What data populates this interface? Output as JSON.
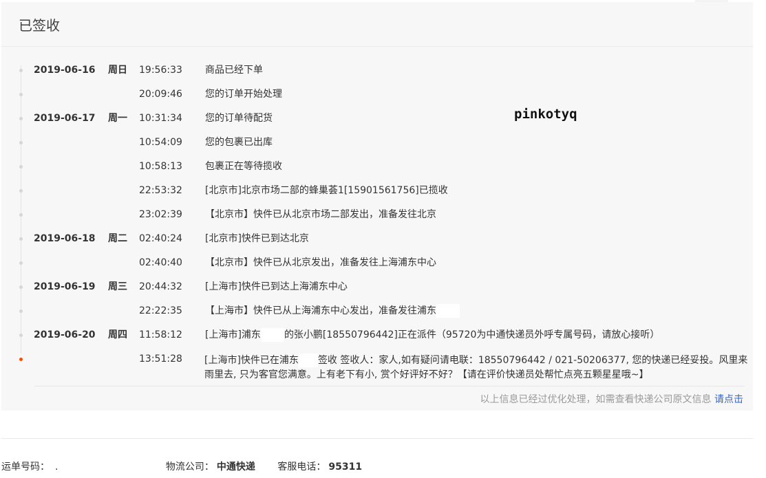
{
  "header": {
    "title": "已签收"
  },
  "watermark": "pinkotyq",
  "events": [
    {
      "date": "2019-06-16",
      "weekday": "周日",
      "time": "19:56:33",
      "desc": "商品已经下单"
    },
    {
      "date": "",
      "weekday": "",
      "time": "20:09:46",
      "desc": "您的订单开始处理"
    },
    {
      "date": "2019-06-17",
      "weekday": "周一",
      "time": "10:31:34",
      "desc": "您的订单待配货"
    },
    {
      "date": "",
      "weekday": "",
      "time": "10:54:09",
      "desc": "您的包裹已出库"
    },
    {
      "date": "",
      "weekday": "",
      "time": "10:58:13",
      "desc": "包裹正在等待揽收"
    },
    {
      "date": "",
      "weekday": "",
      "time": "22:53:32",
      "desc": "[北京市]北京市场二部的蜂巢荟1[15901561756]已揽收"
    },
    {
      "date": "",
      "weekday": "",
      "time": "23:02:39",
      "desc": "【北京市】快件已从北京市场二部发出，准备发往北京"
    },
    {
      "date": "2019-06-18",
      "weekday": "周二",
      "time": "02:40:24",
      "desc": "[北京市]快件已到达北京"
    },
    {
      "date": "",
      "weekday": "",
      "time": "02:40:40",
      "desc": "【北京市】快件已从北京发出，准备发往上海浦东中心"
    },
    {
      "date": "2019-06-19",
      "weekday": "周三",
      "time": "20:44:32",
      "desc": "[上海市]快件已到达上海浦东中心"
    },
    {
      "date": "",
      "weekday": "",
      "time": "22:22:35",
      "desc_a": "【上海市】快件已从上海浦东中心发出，准备发往浦东"
    },
    {
      "date": "2019-06-20",
      "weekday": "周四",
      "time": "11:58:12",
      "desc_a": "[上海市]浦东",
      "desc_b": "的张小鹏[18550796442]正在派件（95720为中通快递员外呼专属号码，请放心接听）"
    },
    {
      "date": "",
      "weekday": "",
      "time": "13:51:28",
      "desc_a": "[上海市]快件已在浦东",
      "desc_b": "签收 签收人：家人,如有疑问请电联：18550796442 / 021-50206377, 您的快递已经妥投。风里来雨里去, 只为客官您满意。上有老下有小, 赏个好评好不好？【请在评价快递员处帮忙点亮五颗星星哦~】"
    }
  ],
  "footer": {
    "note": "以上信息已经过优化处理，如需查看快递公司原文信息",
    "link": "请点击"
  },
  "shipping": {
    "tracking_label": "运单号码：",
    "tracking_value": ".",
    "carrier_label": "物流公司：",
    "carrier_value": "中通快递",
    "phone_label": "客服电话：",
    "phone_value": "95311"
  }
}
